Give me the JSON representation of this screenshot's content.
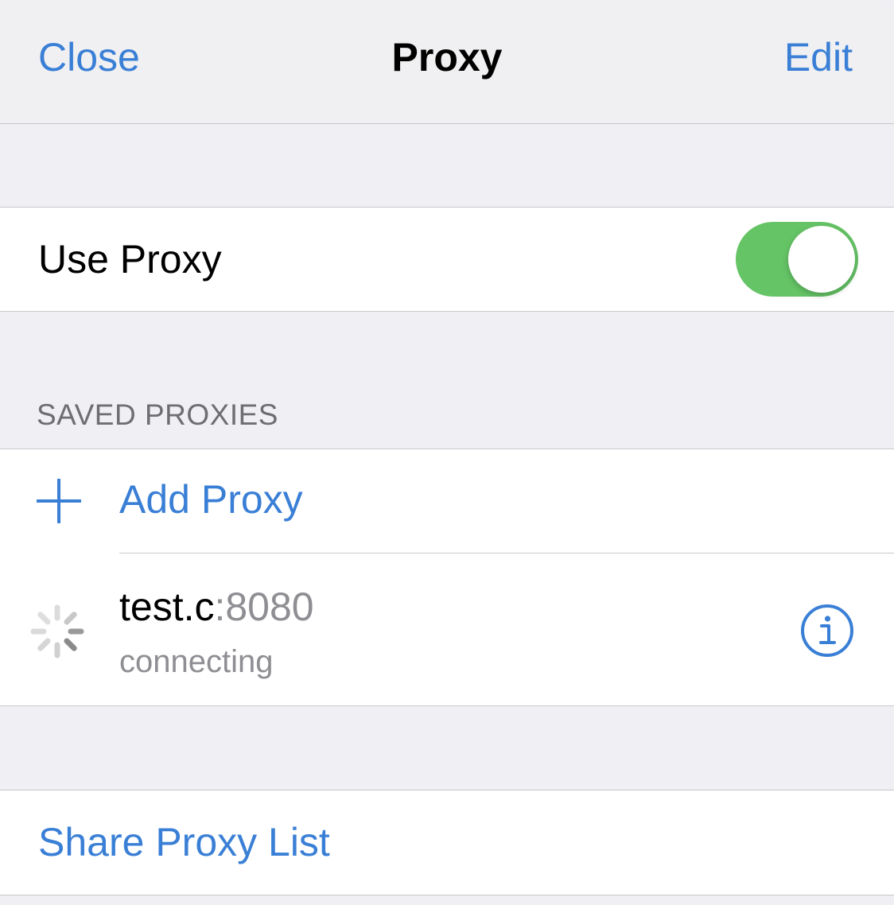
{
  "nav": {
    "close_label": "Close",
    "title": "Proxy",
    "edit_label": "Edit"
  },
  "use_proxy": {
    "label": "Use Proxy",
    "enabled": true,
    "toggle_color": "#65c466"
  },
  "saved_proxies": {
    "header": "SAVED PROXIES",
    "add_label": "Add Proxy",
    "add_icon": "plus-icon",
    "items": [
      {
        "host": "test.c",
        "port": ":8080",
        "status": "connecting",
        "status_icon": "spinner-icon",
        "detail_icon": "info-icon"
      }
    ]
  },
  "share": {
    "label": "Share Proxy List"
  },
  "colors": {
    "accent": "#3a7fd6",
    "background": "#efeff4",
    "secondary_text": "#8e8e93"
  }
}
